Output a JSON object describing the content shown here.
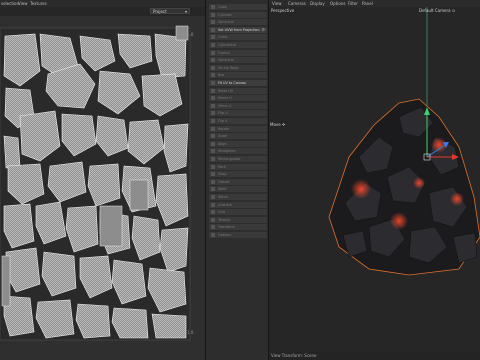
{
  "menubar": {
    "left_items": [
      "selection",
      "View",
      "Textures"
    ],
    "right_items": [
      "View",
      "Cameras",
      "Display",
      "Options",
      "Filter",
      "Panel"
    ]
  },
  "uv_toolbar": {
    "dropdown_value": "Project"
  },
  "uv_panel": {
    "corner_labels": [
      "1.0",
      "1.0"
    ]
  },
  "middle_panel": {
    "rows": [
      {
        "label": "Cube",
        "heading": false
      },
      {
        "label": "Cylinder",
        "heading": false
      },
      {
        "label": "Spherical",
        "heading": false
      },
      {
        "label": "Set UVW from Projection",
        "heading": true,
        "gear": true
      },
      {
        "label": "Cubic",
        "heading": false
      },
      {
        "label": "Cylindrical",
        "heading": false
      },
      {
        "label": "Frontal",
        "heading": false
      },
      {
        "label": "Spherical",
        "heading": false
      },
      {
        "label": "Shrink Wrap",
        "heading": false
      },
      {
        "label": "Box",
        "heading": false
      },
      {
        "label": "Fit UV to Canvas",
        "heading": true
      },
      {
        "label": "Relax UV",
        "heading": false
      },
      {
        "label": "Mirror U",
        "heading": false
      },
      {
        "label": "Mirror V",
        "heading": false
      },
      {
        "label": "Flip U",
        "heading": false
      },
      {
        "label": "Flip V",
        "heading": false
      },
      {
        "label": "Rotate",
        "heading": false
      },
      {
        "label": "Scale",
        "heading": false
      },
      {
        "label": "Align",
        "heading": false
      },
      {
        "label": "Straighten",
        "heading": false
      },
      {
        "label": "Rectangulate",
        "heading": false
      },
      {
        "label": "Pack",
        "heading": false
      },
      {
        "label": "Snap",
        "heading": false
      },
      {
        "label": "Distort",
        "heading": false
      },
      {
        "label": "Weld",
        "heading": false
      },
      {
        "label": "Stitch",
        "heading": false
      },
      {
        "label": "Unstitch",
        "heading": false
      },
      {
        "label": "Grid",
        "heading": false
      },
      {
        "label": "Terrace",
        "heading": false
      },
      {
        "label": "Transform",
        "heading": false
      },
      {
        "label": "Options",
        "heading": false
      }
    ]
  },
  "viewport": {
    "view_name": "Perspective",
    "camera_label": "Default Camera ⊙",
    "move_label": "Move ✣",
    "status_text": "View Transform: Scene"
  }
}
